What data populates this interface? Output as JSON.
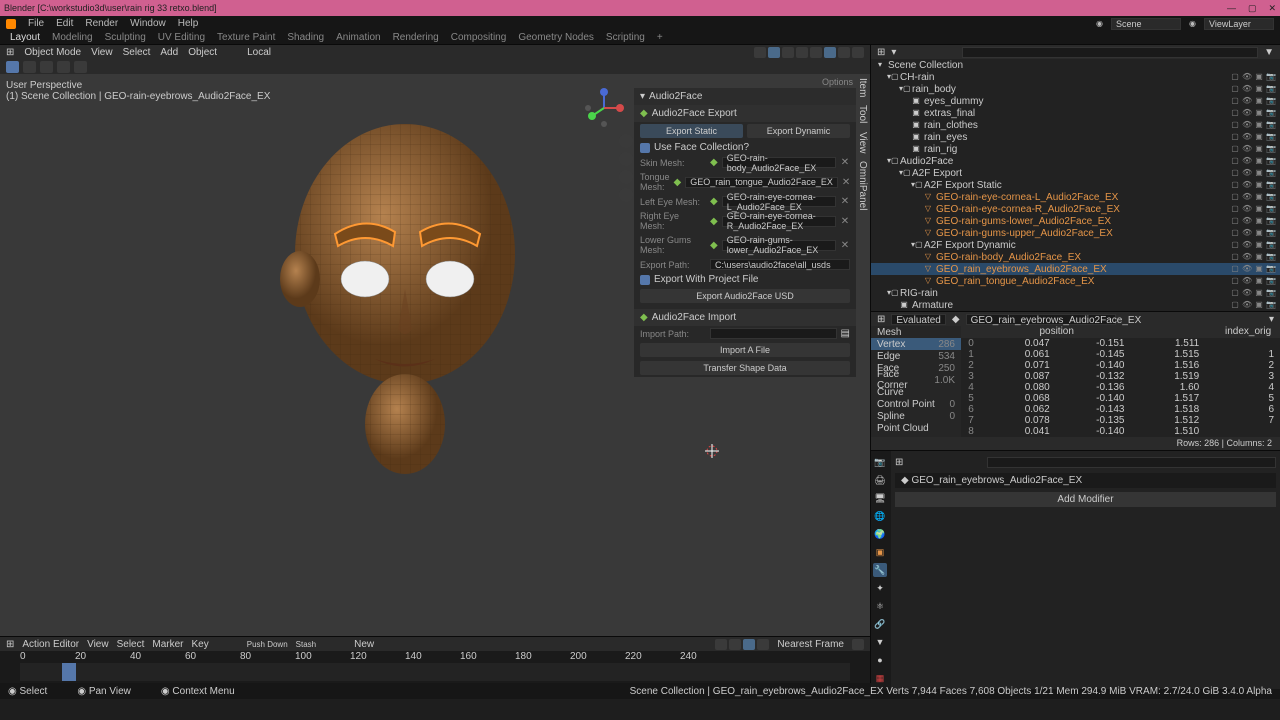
{
  "title": "Blender  [C:\\workstudio3d\\user\\rain rig 33 retxo.blend]",
  "menu": [
    "File",
    "Edit",
    "Render",
    "Window",
    "Help"
  ],
  "workspaces": [
    "Layout",
    "Modeling",
    "Sculpting",
    "UV Editing",
    "Texture Paint",
    "Shading",
    "Animation",
    "Rendering",
    "Compositing",
    "Geometry Nodes",
    "Scripting",
    "+"
  ],
  "scene": "Scene",
  "viewlayer": "ViewLayer",
  "vp_header": {
    "mode": "Object Mode",
    "menus": [
      "View",
      "Select",
      "Add",
      "Object"
    ],
    "orient": "Local"
  },
  "vp_label1": "User Perspective",
  "vp_label2": "(1) Scene Collection | GEO-rain-eyebrows_Audio2Face_EX",
  "side_tabs": [
    "Item",
    "Tool",
    "View",
    "OmniPanel"
  ],
  "a2f_panel": {
    "title": "Audio2Face",
    "export_hdr": "Audio2Face Export",
    "btn_static": "Export Static",
    "btn_dynamic": "Export Dynamic",
    "use_face": "Use Face Collection?",
    "rows": [
      {
        "label": "Skin Mesh:",
        "val": "GEO-rain-body_Audio2Face_EX"
      },
      {
        "label": "Tongue Mesh:",
        "val": "GEO_rain_tongue_Audio2Face_EX"
      },
      {
        "label": "Left Eye Mesh:",
        "val": "GEO-rain-eye-cornea-L_Audio2Face_EX"
      },
      {
        "label": "Right Eye Mesh:",
        "val": "GEO-rain-eye-cornea-R_Audio2Face_EX"
      },
      {
        "label": "Lower Gums Mesh:",
        "val": "GEO-rain-gums-lower_Audio2Face_EX"
      }
    ],
    "export_path_lbl": "Export Path:",
    "export_path": "C:\\users\\audio2face\\all_usds",
    "export_proj": "Export With Project File",
    "btn_export": "Export Audio2Face USD",
    "import_hdr": "Audio2Face Import",
    "import_path_lbl": "Import Path:",
    "btn_import": "Import A File",
    "btn_transfer": "Transfer Shape Data"
  },
  "options": "Options",
  "outliner": {
    "root": "Scene Collection",
    "items": [
      {
        "ind": 12,
        "t": "col",
        "n": "CH-rain"
      },
      {
        "ind": 24,
        "t": "col",
        "n": "rain_body"
      },
      {
        "ind": 36,
        "t": "obj",
        "n": "eyes_dummy"
      },
      {
        "ind": 36,
        "t": "obj",
        "n": "extras_final"
      },
      {
        "ind": 36,
        "t": "obj",
        "n": "rain_clothes"
      },
      {
        "ind": 36,
        "t": "obj",
        "n": "rain_eyes"
      },
      {
        "ind": 36,
        "t": "obj",
        "n": "rain_rig"
      },
      {
        "ind": 12,
        "t": "col",
        "n": "Audio2Face"
      },
      {
        "ind": 24,
        "t": "col",
        "n": "A2F Export"
      },
      {
        "ind": 36,
        "t": "col",
        "n": "A2F Export Static"
      },
      {
        "ind": 48,
        "t": "mesh",
        "n": "GEO-rain-eye-cornea-L_Audio2Face_EX"
      },
      {
        "ind": 48,
        "t": "mesh",
        "n": "GEO-rain-eye-cornea-R_Audio2Face_EX"
      },
      {
        "ind": 48,
        "t": "mesh",
        "n": "GEO-rain-gums-lower_Audio2Face_EX"
      },
      {
        "ind": 48,
        "t": "mesh",
        "n": "GEO-rain-gums-upper_Audio2Face_EX"
      },
      {
        "ind": 36,
        "t": "col",
        "n": "A2F Export Dynamic"
      },
      {
        "ind": 48,
        "t": "mesh",
        "n": "GEO-rain-body_Audio2Face_EX"
      },
      {
        "ind": 48,
        "t": "mesh",
        "n": "GEO_rain_eyebrows_Audio2Face_EX",
        "sel": true
      },
      {
        "ind": 48,
        "t": "mesh",
        "n": "GEO_rain_tongue_Audio2Face_EX"
      },
      {
        "ind": 12,
        "t": "col",
        "n": "RIG-rain"
      },
      {
        "ind": 24,
        "t": "obj",
        "n": "Armature"
      }
    ]
  },
  "spreadsheet": {
    "eval": "Evaluated",
    "obj": "GEO_rain_eyebrows_Audio2Face_EX",
    "domains": [
      {
        "n": "Mesh",
        "c": ""
      },
      {
        "n": "Vertex",
        "c": "286",
        "sel": true
      },
      {
        "n": "Edge",
        "c": "534"
      },
      {
        "n": "Face",
        "c": "250"
      },
      {
        "n": "Face Corner",
        "c": "1.0K"
      },
      {
        "n": "Curve",
        "c": ""
      },
      {
        "n": "Control Point",
        "c": "0"
      },
      {
        "n": "Spline",
        "c": "0"
      },
      {
        "n": "Point Cloud",
        "c": ""
      }
    ],
    "cols": [
      "",
      "position",
      "",
      "",
      "index_orig"
    ],
    "rows": [
      [
        "0",
        "0.047",
        "-0.151",
        "1.511",
        ""
      ],
      [
        "1",
        "0.061",
        "-0.145",
        "1.515",
        "1"
      ],
      [
        "2",
        "0.071",
        "-0.140",
        "1.516",
        "2"
      ],
      [
        "3",
        "0.087",
        "-0.132",
        "1.519",
        "3"
      ],
      [
        "4",
        "0.080",
        "-0.136",
        "1.60",
        "4"
      ],
      [
        "5",
        "0.068",
        "-0.140",
        "1.517",
        "5"
      ],
      [
        "6",
        "0.062",
        "-0.143",
        "1.518",
        "6"
      ],
      [
        "7",
        "0.078",
        "-0.135",
        "1.512",
        "7"
      ],
      [
        "8",
        "0.041",
        "-0.140",
        "1.510",
        ""
      ]
    ],
    "footer": "Rows: 286  |  Columns: 2"
  },
  "props": {
    "obj": "GEO_rain_eyebrows_Audio2Face_EX",
    "add": "Add Modifier"
  },
  "timeline": {
    "editor": "Action Editor",
    "menus": [
      "View",
      "Select",
      "Marker",
      "Key"
    ],
    "push": "Push Down",
    "stash": "Stash",
    "new": "New",
    "nearest": "Nearest Frame",
    "ticks": [
      0,
      20,
      40,
      60,
      80,
      100,
      120,
      140,
      160,
      180,
      200,
      220,
      240
    ]
  },
  "status": {
    "l": "Select",
    "m": "Pan View",
    "r": "Context Menu",
    "info": "Scene Collection | GEO_rain_eyebrows_Audio2Face_EX   Verts 7,944  Faces 7,608   Objects 1/21   Mem 294.9 MiB   VRAM: 2.7/24.0 GiB   3.4.0 Alpha"
  }
}
